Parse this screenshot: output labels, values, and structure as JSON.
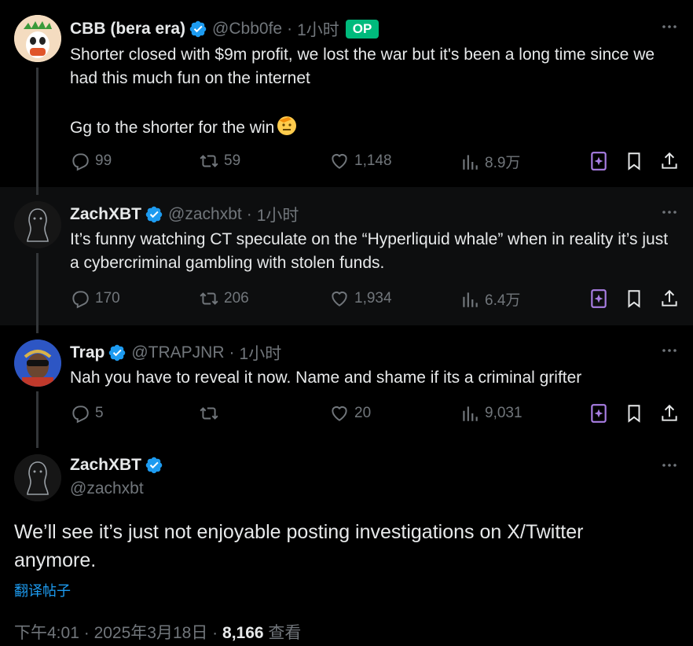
{
  "thread": [
    {
      "name": "CBB (bera era)",
      "handle": "@Cbb0fe",
      "time_sep": "·",
      "time": "1小时",
      "op_badge": "OP",
      "text": "Shorter closed with $9m profit, we lost the war but it's been a long time since we had this much fun on the internet\n\nGg to the shorter for the win",
      "emoji": "saluting-face",
      "replies": "99",
      "reposts": "59",
      "likes": "1,148",
      "views": "8.9万"
    },
    {
      "name": "ZachXBT",
      "handle": "@zachxbt",
      "time_sep": "·",
      "time": "1小时",
      "text": "It’s funny watching CT speculate on the “Hyperliquid whale” when in reality it’s just a cybercriminal gambling with stolen funds.",
      "replies": "170",
      "reposts": "206",
      "likes": "1,934",
      "views": "6.4万"
    },
    {
      "name": "Trap",
      "handle": "@TRAPJNR",
      "time_sep": "·",
      "time": "1小时",
      "text": "Nah you have to reveal it now. Name and shame if its a criminal grifter",
      "replies": "5",
      "reposts": "",
      "likes": "20",
      "views": "9,031"
    }
  ],
  "main": {
    "name": "ZachXBT",
    "handle": "@zachxbt",
    "text": "We’ll see it’s just not enjoyable posting investigations on X/Twitter anymore.",
    "translate": "翻译帖子",
    "time": "下午4:01",
    "dot1": "·",
    "date": "2025年3月18日",
    "dot2": "·",
    "view_count": "8,166",
    "views_label": "查看"
  },
  "colors": {
    "background": "#000000",
    "text": "#e7e9ea",
    "muted": "#71767b",
    "accent": "#1d9bf0",
    "op_badge": "#00ba7c",
    "grok": "#a97ee4"
  }
}
